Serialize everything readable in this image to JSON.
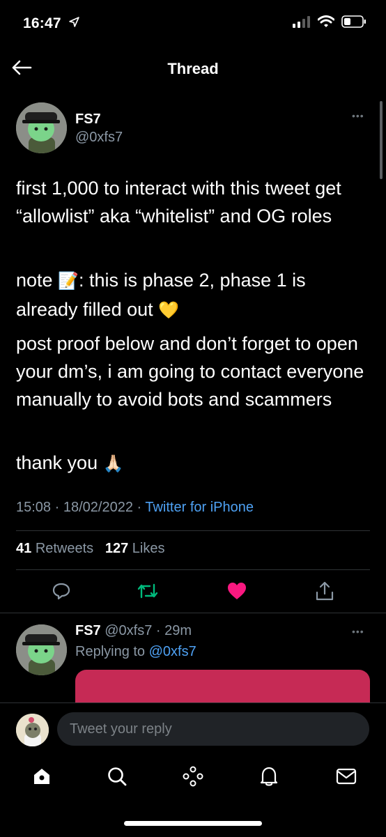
{
  "status_bar": {
    "time": "16:47"
  },
  "header": {
    "title": "Thread"
  },
  "tweet": {
    "name": "FS7",
    "handle": "@0xfs7",
    "more": "•••",
    "paragraphs": {
      "p1": "first 1,000 to interact with this tweet get “allowlist” aka “whitelist” and OG roles",
      "p2a": "note ",
      "p2b": ": this is phase 2, phase 1 is already filled out",
      "p3": "post proof below and don’t forget to open your dm’s, i am going to contact everyone manually to avoid bots and scammers",
      "p4": "thank you"
    },
    "emoji": {
      "memo": "📝",
      "heart": "💛",
      "pray": "🙏🏻"
    },
    "time": "15:08",
    "date": "18/02/2022",
    "source": "Twitter for iPhone",
    "retweets": "41",
    "retweets_label": "Retweets",
    "likes": "127",
    "likes_label": "Likes",
    "liked": true,
    "colors": {
      "like": "#f91880",
      "retweet": "#00ba7c",
      "link": "#4ea1f3"
    }
  },
  "reply": {
    "name": "FS7",
    "handle": "@0xfs7",
    "ago": "29m",
    "replying_prefix": "Replying to ",
    "replying_to": "@0xfs7",
    "more": "•••",
    "media_color": "#c62a55"
  },
  "composer": {
    "placeholder": "Tweet your reply"
  },
  "tabs": [
    "home",
    "search",
    "spaces",
    "notifications",
    "messages"
  ]
}
